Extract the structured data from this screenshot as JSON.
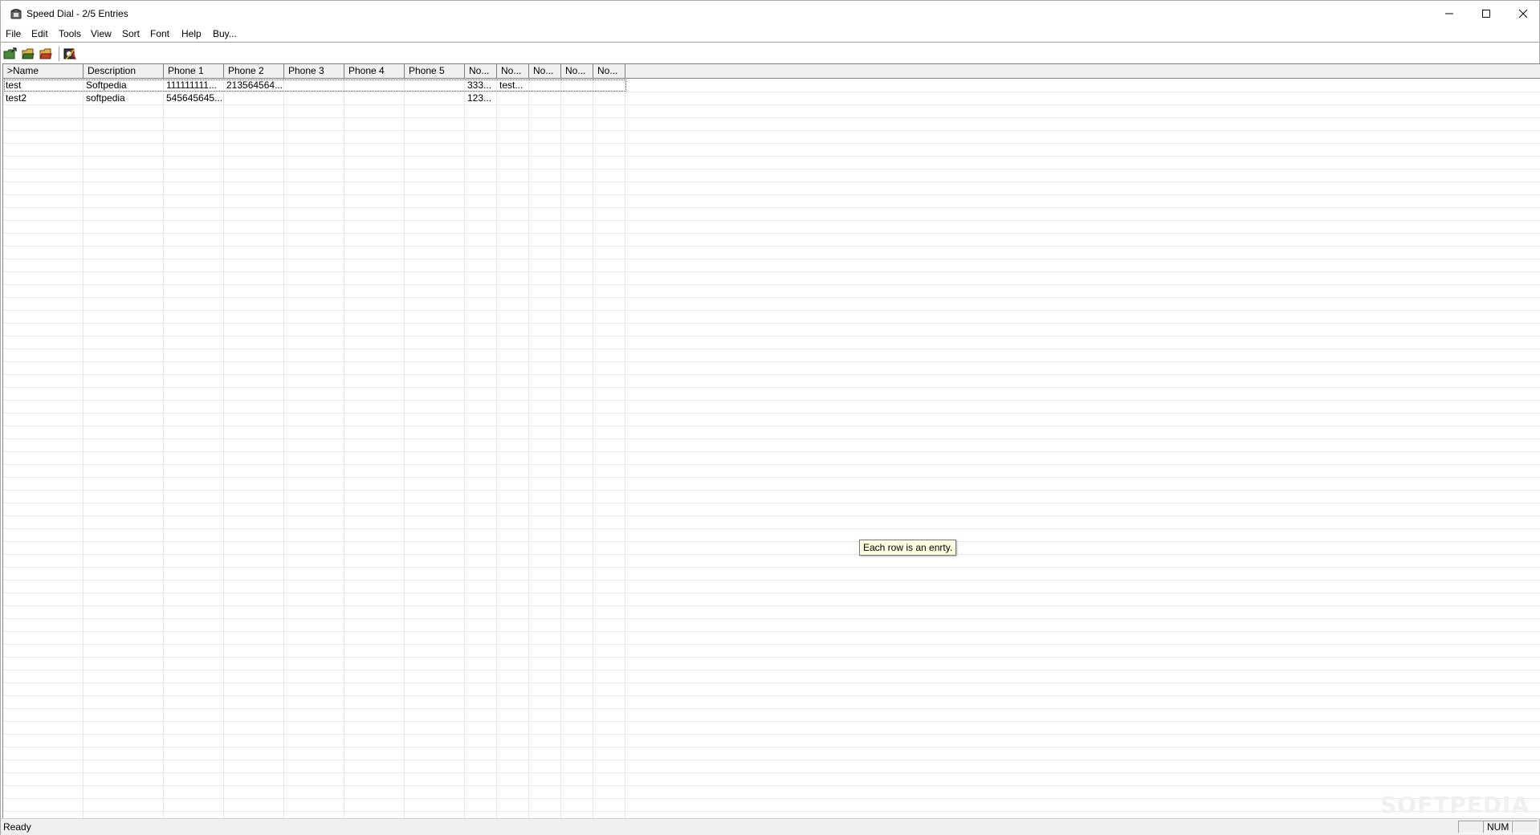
{
  "window": {
    "title": "Speed Dial - 2/5 Entries",
    "app_icon": "telephone-icon",
    "controls": [
      "minimize-icon",
      "maximize-icon",
      "close-icon"
    ]
  },
  "menu": [
    "File",
    "Edit",
    "Tools",
    "View",
    "Sort",
    "Font",
    "Help",
    "Buy..."
  ],
  "toolbar": {
    "buttons": [
      {
        "name": "new-entry-icon"
      },
      {
        "name": "open-icon"
      },
      {
        "name": "save-icon"
      },
      {
        "name": "dial-tools-icon"
      }
    ]
  },
  "grid": {
    "columns": [
      ">Name",
      "Description",
      "Phone 1",
      "Phone 2",
      "Phone 3",
      "Phone 4",
      "Phone 5",
      "No...",
      "No...",
      "No...",
      "No...",
      "No..."
    ],
    "rows": [
      [
        "test",
        "Softpedia",
        "111111111...",
        "213564564...",
        "",
        "",
        "",
        "333...",
        "test...",
        "",
        "",
        ""
      ],
      [
        "test2",
        "softpedia",
        "545645645...",
        "",
        "",
        "",
        "",
        "123...",
        "",
        "",
        "",
        ""
      ]
    ]
  },
  "tooltip": "Each row is an enrty.",
  "status": {
    "text": "Ready",
    "num_indicator": "NUM"
  },
  "watermark": "SOFTPEDIA"
}
